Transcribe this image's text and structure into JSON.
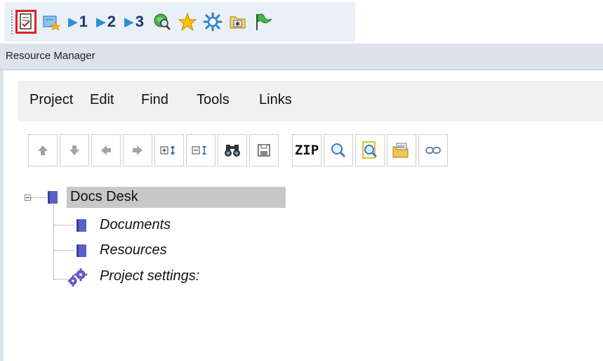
{
  "quickbar": {
    "items": [
      {
        "icon": "checklist-doc-icon"
      },
      {
        "icon": "favorites-book-icon"
      },
      {
        "icon": "jump-1-icon",
        "label": "1"
      },
      {
        "icon": "jump-2-icon",
        "label": "2"
      },
      {
        "icon": "jump-3-icon",
        "label": "3"
      },
      {
        "icon": "globe-search-icon"
      },
      {
        "icon": "star-icon"
      },
      {
        "icon": "sun-settings-icon"
      },
      {
        "icon": "folder-star-icon"
      },
      {
        "icon": "green-flag-icon"
      }
    ]
  },
  "window": {
    "title": "Resource Manager"
  },
  "menu": {
    "items": [
      "Project",
      "Edit",
      "Find",
      "Tools",
      "Links"
    ]
  },
  "toolbar": {
    "zip_label": "ZIP",
    "icons": [
      "arrow-up-icon",
      "arrow-down-icon",
      "arrow-left-icon",
      "arrow-right-icon",
      "expand-all-icon",
      "collapse-all-icon",
      "binoculars-icon",
      "save-icon",
      "zip-icon",
      "magnifier-icon",
      "preview-doc-icon",
      "spellcheck-folder-icon",
      "link-icon"
    ]
  },
  "tree": {
    "root": {
      "label": "Docs Desk",
      "selected": true
    },
    "children": [
      {
        "label": "Documents",
        "icon": "book-icon"
      },
      {
        "label": "Resources",
        "icon": "book-icon"
      },
      {
        "label": "Project settings:",
        "icon": "gears-icon"
      }
    ]
  },
  "colors": {
    "accent_red": "#e02020",
    "selection_gray": "#c8c8c8",
    "book_blue": "#5a62c8"
  }
}
